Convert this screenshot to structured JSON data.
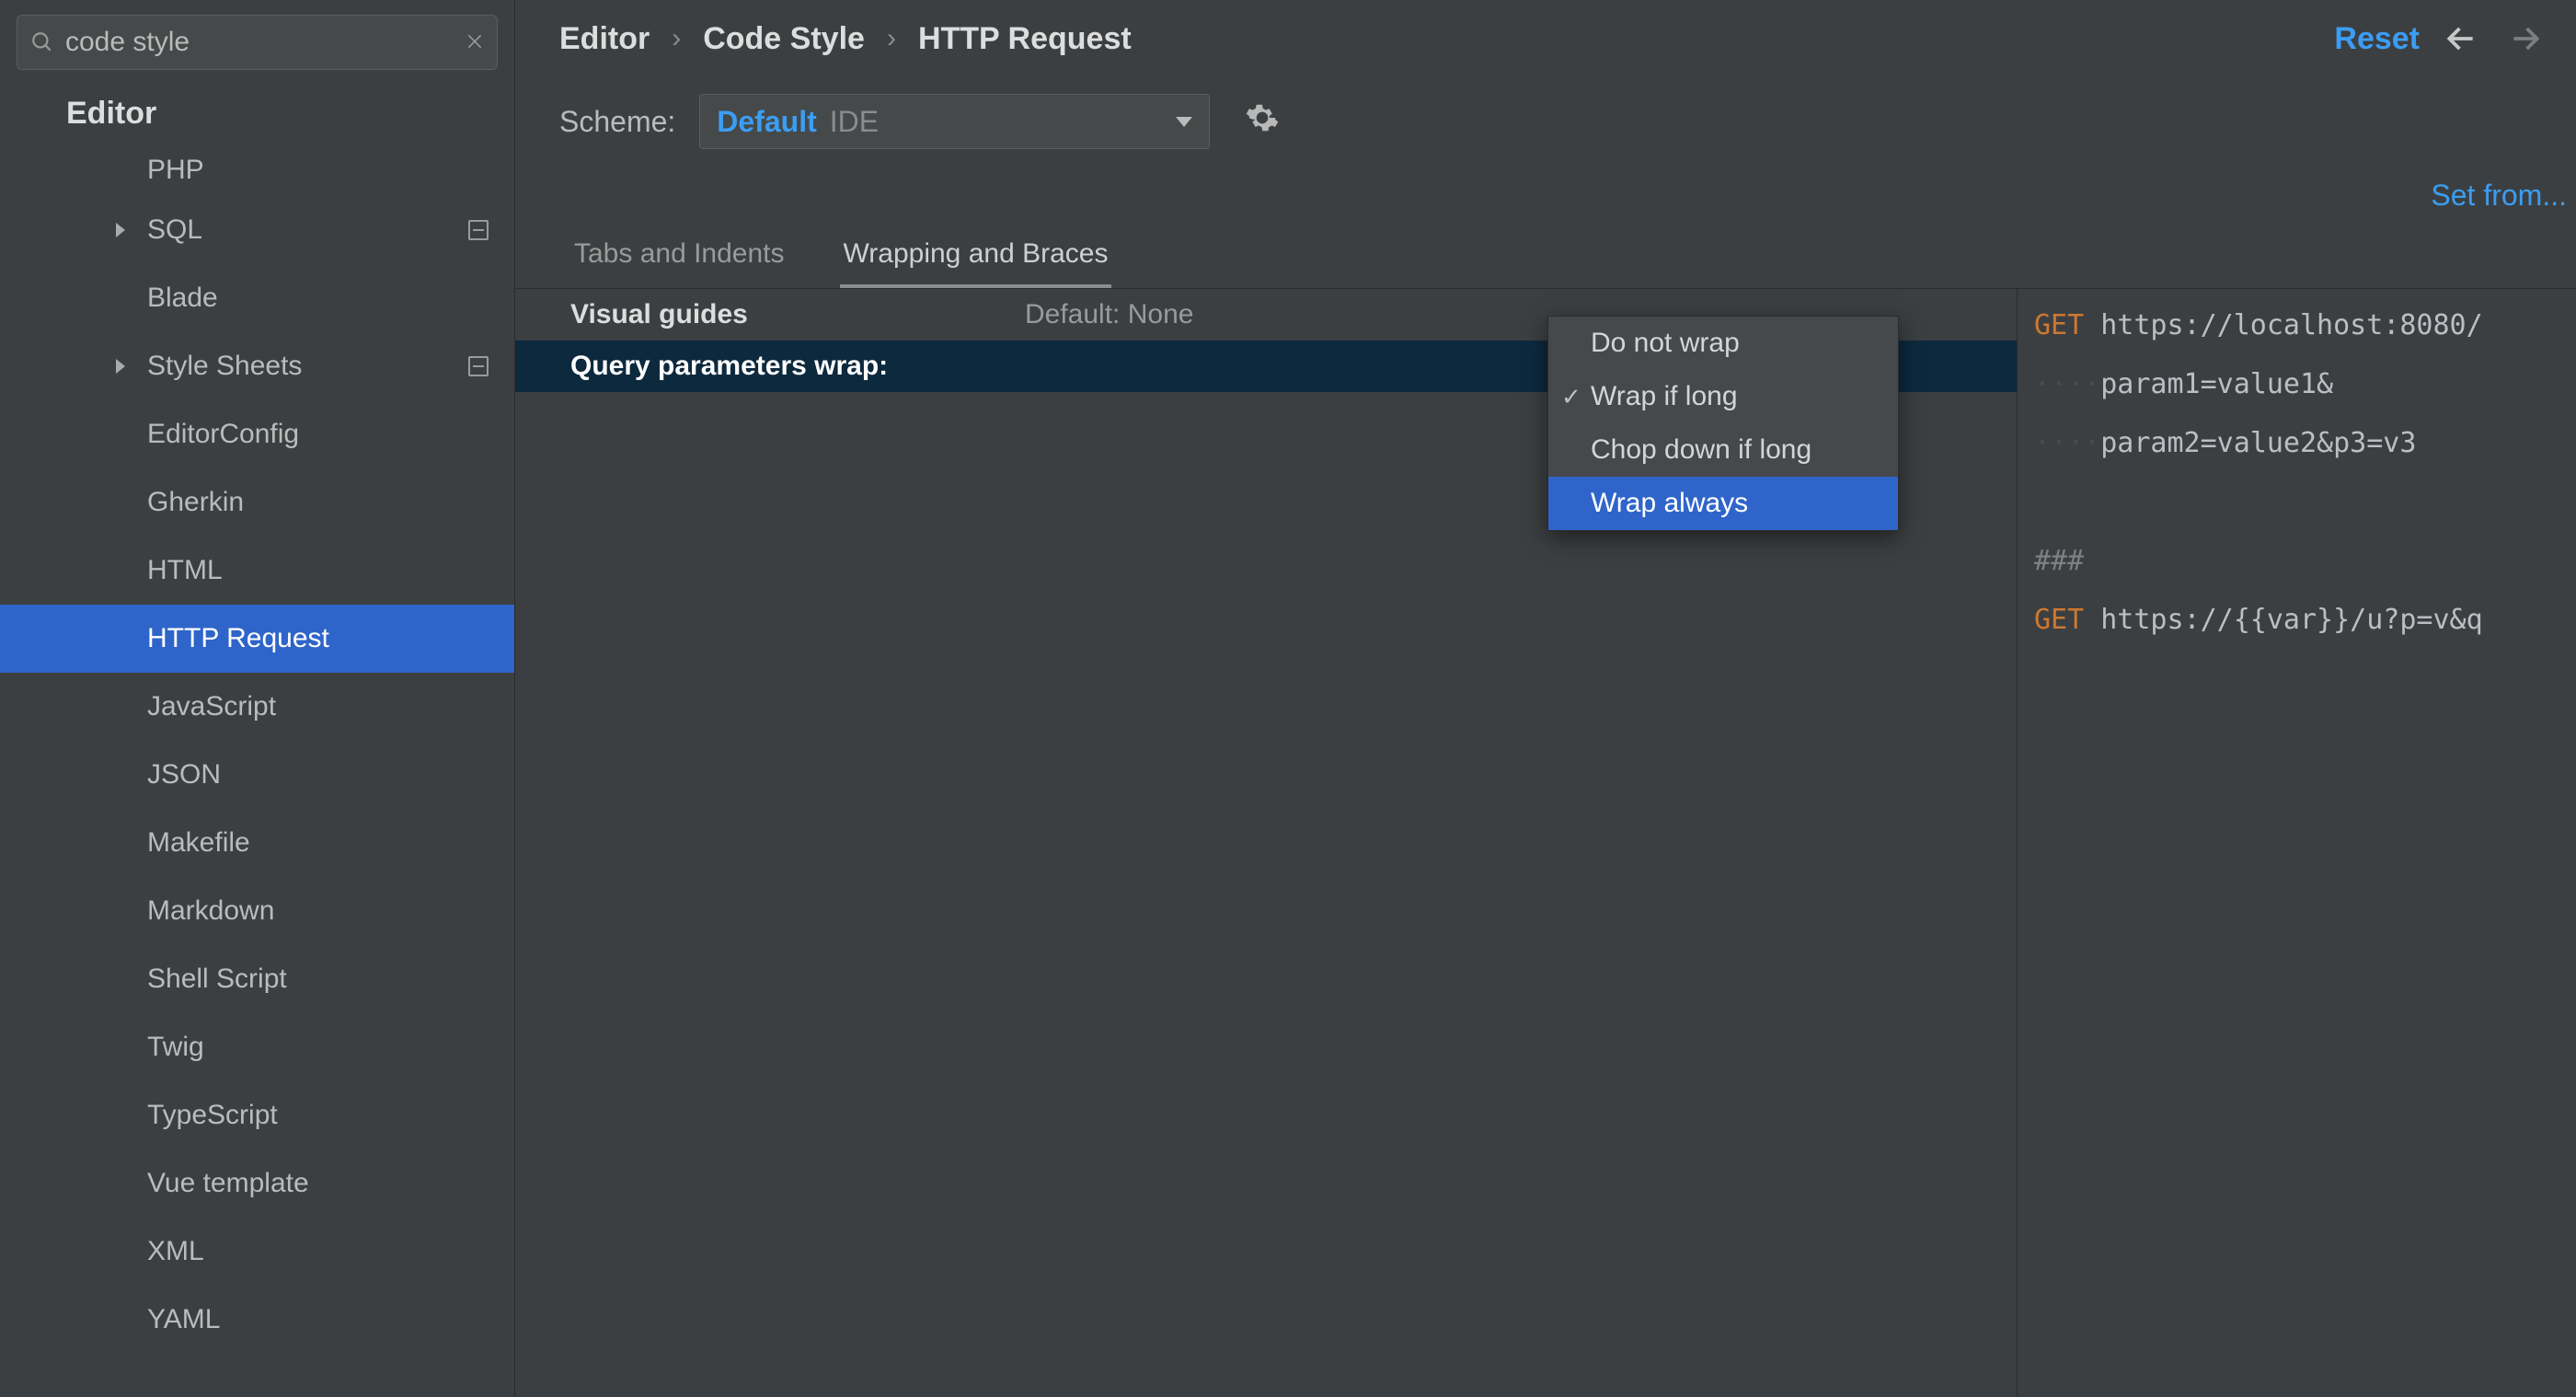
{
  "search": {
    "value": "code style"
  },
  "sidebar": {
    "section_title": "Editor",
    "items": [
      {
        "label": "PHP",
        "chevron": false,
        "collapse_icon": false,
        "selected": false,
        "first_cut": true
      },
      {
        "label": "SQL",
        "chevron": true,
        "collapse_icon": true,
        "selected": false
      },
      {
        "label": "Blade",
        "chevron": false,
        "collapse_icon": false,
        "selected": false
      },
      {
        "label": "Style Sheets",
        "chevron": true,
        "collapse_icon": true,
        "selected": false
      },
      {
        "label": "EditorConfig",
        "chevron": false,
        "collapse_icon": false,
        "selected": false
      },
      {
        "label": "Gherkin",
        "chevron": false,
        "collapse_icon": false,
        "selected": false
      },
      {
        "label": "HTML",
        "chevron": false,
        "collapse_icon": false,
        "selected": false
      },
      {
        "label": "HTTP Request",
        "chevron": false,
        "collapse_icon": false,
        "selected": true
      },
      {
        "label": "JavaScript",
        "chevron": false,
        "collapse_icon": false,
        "selected": false
      },
      {
        "label": "JSON",
        "chevron": false,
        "collapse_icon": false,
        "selected": false
      },
      {
        "label": "Makefile",
        "chevron": false,
        "collapse_icon": false,
        "selected": false
      },
      {
        "label": "Markdown",
        "chevron": false,
        "collapse_icon": false,
        "selected": false
      },
      {
        "label": "Shell Script",
        "chevron": false,
        "collapse_icon": false,
        "selected": false
      },
      {
        "label": "Twig",
        "chevron": false,
        "collapse_icon": false,
        "selected": false
      },
      {
        "label": "TypeScript",
        "chevron": false,
        "collapse_icon": false,
        "selected": false
      },
      {
        "label": "Vue template",
        "chevron": false,
        "collapse_icon": false,
        "selected": false
      },
      {
        "label": "XML",
        "chevron": false,
        "collapse_icon": false,
        "selected": false
      },
      {
        "label": "YAML",
        "chevron": false,
        "collapse_icon": false,
        "selected": false
      }
    ]
  },
  "breadcrumb": {
    "root": "Editor",
    "mid": "Code Style",
    "leaf": "HTTP Request",
    "reset": "Reset"
  },
  "scheme": {
    "label": "Scheme:",
    "primary": "Default",
    "secondary": "IDE"
  },
  "set_from": "Set from...",
  "tabs": {
    "tab0": "Tabs and Indents",
    "tab1": "Wrapping and Braces"
  },
  "settings": {
    "row0": {
      "label": "Visual guides",
      "value": "Default: None"
    },
    "row1": {
      "label": "Query parameters wrap:",
      "value": ""
    }
  },
  "dropdown": {
    "opt0": "Do not wrap",
    "opt1": "Wrap if long",
    "opt2": "Chop down if long",
    "opt3": "Wrap always",
    "checked_index": 1,
    "highlight_index": 3
  },
  "preview": {
    "line1_method": "GET",
    "line1_rest": " https://localhost:8080/",
    "line2_indent": "····",
    "line2": "param1=value1&",
    "line3_indent": "····",
    "line3": "param2=value2&p3=v3",
    "line5": "###",
    "line6_method": "GET",
    "line6_rest": " https://{{var}}/u?p=v&q"
  },
  "colors": {
    "accent": "#2f65ca",
    "link": "#3b9df3",
    "keyword": "#cc7832"
  }
}
